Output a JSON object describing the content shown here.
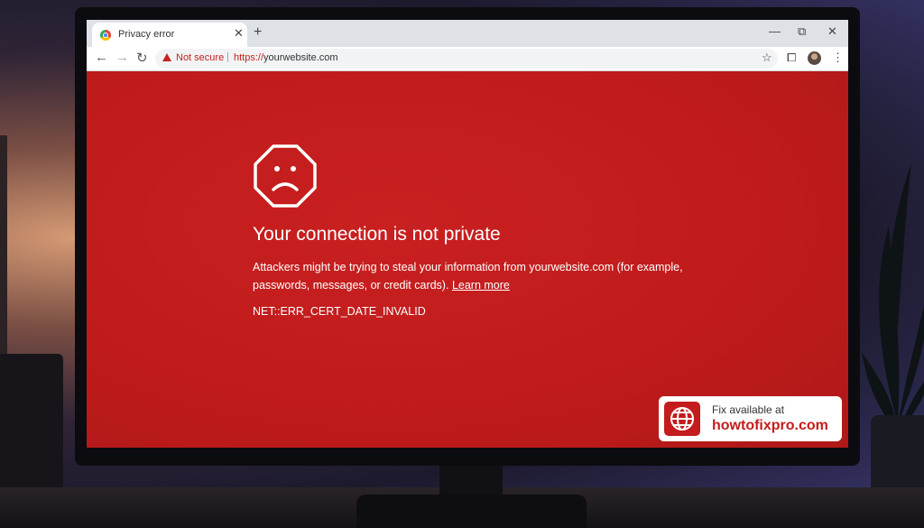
{
  "tab": {
    "title": "Privacy error",
    "close": "✕",
    "new_tab": "+"
  },
  "window_controls": {
    "minimize": "—",
    "restore": "⧉",
    "close": "✕"
  },
  "toolbar": {
    "back": "←",
    "forward": "→",
    "reload": "↻",
    "security_label": "Not secure",
    "separator": "|",
    "url_protocol": "https://",
    "url_host": "yourwebsite.com",
    "star": "☆",
    "extensions": "⧠",
    "menu": "⋮"
  },
  "page": {
    "headline": "Your connection is not private",
    "description": "Attackers might be trying to steal your information from yourwebsite.com  (for example, passwords, messages, or credit cards).",
    "learn_more": "Learn more",
    "error_code": "NET::ERR_CERT_DATE_INVALID"
  },
  "badge": {
    "line1": "Fix available at",
    "line2": "howtofixpro.com"
  },
  "colors": {
    "error_red": "#c41c1c",
    "warning_red": "#c5221f"
  },
  "icons": [
    "sad-octagon-icon",
    "warning-triangle-icon",
    "globe-icon",
    "chrome-favicon-icon"
  ]
}
